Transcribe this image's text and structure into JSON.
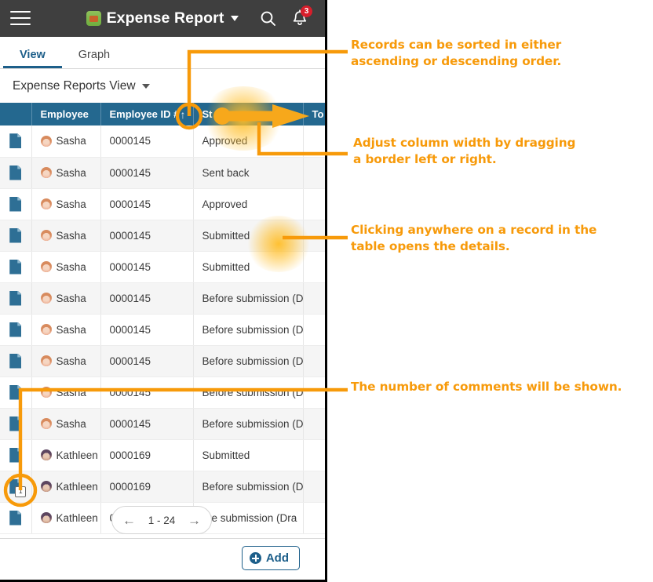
{
  "window": {
    "topbar": {
      "menu_icon": "hamburger-icon",
      "app_icon": "app-logo-icon",
      "title": "Expense Report",
      "title_caret": "chevron-down-icon",
      "search_icon": "search-icon",
      "bell_icon": "bell-icon",
      "notification_count": "3"
    },
    "tabs": [
      {
        "label": "View",
        "active": true
      },
      {
        "label": "Graph",
        "active": false
      }
    ],
    "view_selector": {
      "label": "Expense Reports View",
      "caret": "chevron-down-icon"
    },
    "table": {
      "columns": [
        {
          "key": "doc",
          "label": ""
        },
        {
          "key": "employee",
          "label": "Employee"
        },
        {
          "key": "employee_id",
          "label": "Employee ID #",
          "sort": "ascending",
          "sort_glyph": "↑"
        },
        {
          "key": "status",
          "label": "Status",
          "truncated_label": "St"
        },
        {
          "key": "total",
          "label": "Total",
          "truncated_label": "To"
        }
      ],
      "rows": [
        {
          "employee": "Sasha",
          "avatar": "sasha",
          "employee_id": "0000145",
          "status": "Approved",
          "comments": null
        },
        {
          "employee": "Sasha",
          "avatar": "sasha",
          "employee_id": "0000145",
          "status": "Sent back",
          "comments": null
        },
        {
          "employee": "Sasha",
          "avatar": "sasha",
          "employee_id": "0000145",
          "status": "Approved",
          "comments": null
        },
        {
          "employee": "Sasha",
          "avatar": "sasha",
          "employee_id": "0000145",
          "status": "Submitted",
          "comments": null
        },
        {
          "employee": "Sasha",
          "avatar": "sasha",
          "employee_id": "0000145",
          "status": "Submitted",
          "comments": null
        },
        {
          "employee": "Sasha",
          "avatar": "sasha",
          "employee_id": "0000145",
          "status": "Before submission (Dra",
          "comments": null
        },
        {
          "employee": "Sasha",
          "avatar": "sasha",
          "employee_id": "0000145",
          "status": "Before submission (Dra",
          "comments": null
        },
        {
          "employee": "Sasha",
          "avatar": "sasha",
          "employee_id": "0000145",
          "status": "Before submission (Dra",
          "comments": null
        },
        {
          "employee": "Sasha",
          "avatar": "sasha",
          "employee_id": "0000145",
          "status": "Before submission (Dra",
          "comments": null
        },
        {
          "employee": "Sasha",
          "avatar": "sasha",
          "employee_id": "0000145",
          "status": "Before submission (Dra",
          "comments": null
        },
        {
          "employee": "Kathleen",
          "avatar": "kath",
          "employee_id": "0000169",
          "status": "Submitted",
          "comments": null
        },
        {
          "employee": "Kathleen",
          "avatar": "kath",
          "employee_id": "0000169",
          "status": "Before submission (Dra",
          "comments": "1"
        },
        {
          "employee": "Kathleen",
          "avatar": "kath",
          "employee_id": "0000169",
          "status": "ore submission (Dra",
          "comments": null
        }
      ]
    },
    "pager": {
      "prev_icon": "arrow-left-icon",
      "range": "1 - 24",
      "next_icon": "arrow-right-icon"
    },
    "footer": {
      "add_label": "Add",
      "add_icon": "plus-circle-icon"
    }
  },
  "annotations": {
    "accent_color": "#f79a0a",
    "sort": "Records can be sorted in either\nascending or descending order.",
    "column_width": "Adjust column width by dragging\n a border left or right.",
    "open_details": "Clicking anywhere on a record in the\ntable opens the details.",
    "comments": "The number of comments will be shown."
  }
}
